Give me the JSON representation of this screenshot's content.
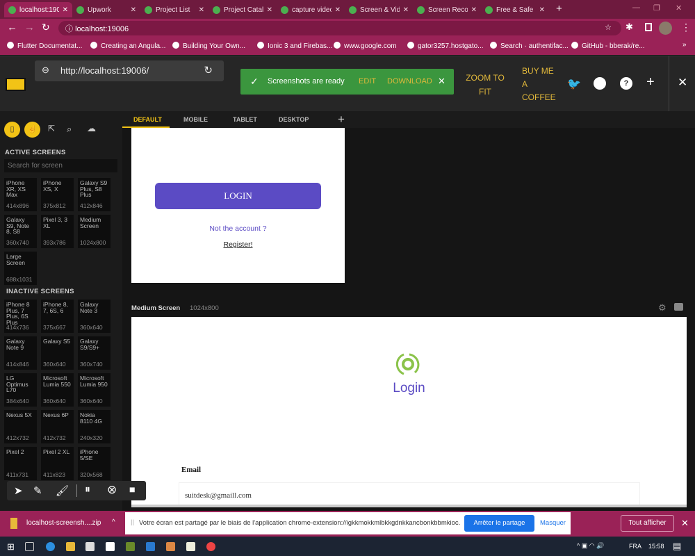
{
  "browser": {
    "tabs": [
      {
        "label": "localhost:19006",
        "active": true
      },
      {
        "label": "Upwork"
      },
      {
        "label": "Project List"
      },
      {
        "label": "Project Catalog"
      },
      {
        "label": "capture video"
      },
      {
        "label": "Screen & Video"
      },
      {
        "label": "Screen Recorder"
      },
      {
        "label": "Free & Safe"
      }
    ],
    "address": "localhost:19006",
    "bookmarks": [
      "Flutter Documentat...",
      "Creating an Angula...",
      "Building Your Own...",
      "Ionic 3 and Firebas...",
      "www.google.com",
      "gator3257.hostgato...",
      "Search · authentifac...",
      "GitHub - bberak/re..."
    ],
    "bookmarks_more": "»"
  },
  "app": {
    "url": "http://localhost:19006/",
    "toast": {
      "message": "Screenshots are ready",
      "edit": "EDIT",
      "download": "DOWNLOAD",
      "close": "✕"
    },
    "zoom_to_fit": "ZOOM TO FIT",
    "buy_coffee": "BUY ME A COFFEE",
    "accent": "#f2c316",
    "sidebar": {
      "active_title": "ACTIVE SCREENS",
      "search_placeholder": "Search for screen",
      "active": [
        {
          "name": "iPhone XR, XS Max",
          "size": "414x896"
        },
        {
          "name": "iPhone XS, X",
          "size": "375x812"
        },
        {
          "name": "Galaxy S9 Plus, S8 Plus",
          "size": "412x846"
        },
        {
          "name": "Galaxy S9, Note 8, S8",
          "size": "360x740"
        },
        {
          "name": "Pixel 3, 3 XL",
          "size": "393x786"
        },
        {
          "name": "Medium Screen",
          "size": "1024x800"
        },
        {
          "name": "Large Screen",
          "size": "688x1031"
        }
      ],
      "inactive_title": "INACTIVE SCREENS",
      "inactive": [
        {
          "name": "iPhone 8 Plus, 7 Plus, 6S Plus",
          "size": "414x736"
        },
        {
          "name": "iPhone 8, 7, 6S, 6",
          "size": "375x667"
        },
        {
          "name": "Galaxy Note 3",
          "size": "360x640"
        },
        {
          "name": "Galaxy Note 9",
          "size": "414x846"
        },
        {
          "name": "Galaxy S5",
          "size": "360x640"
        },
        {
          "name": "Galaxy S9/S9+",
          "size": "360x740"
        },
        {
          "name": "LG Optimus L70",
          "size": "384x640"
        },
        {
          "name": "Microsoft Lumia 550",
          "size": "360x640"
        },
        {
          "name": "Microsoft Lumia 950",
          "size": "360x640"
        },
        {
          "name": "Nexus 5X",
          "size": "412x732"
        },
        {
          "name": "Nexus 6P",
          "size": "412x732"
        },
        {
          "name": "Nokia 8110 4G",
          "size": "240x320"
        },
        {
          "name": "Pixel 2",
          "size": "411x731"
        },
        {
          "name": "Pixel 2 XL",
          "size": "411x823"
        },
        {
          "name": "iPhone 5/SE",
          "size": "320x568"
        }
      ]
    },
    "tabs": [
      "DEFAULT",
      "MOBILE",
      "TABLET",
      "DESKTOP"
    ],
    "preview1": {
      "login_button": "LOGIN",
      "not_account": "Not the account ?",
      "register": "Register!"
    },
    "medium": {
      "title": "Medium Screen",
      "size": "1024x800",
      "heading": "Login",
      "email_label": "Email",
      "email_value": "suitdesk@gmaill.com"
    }
  },
  "downloads": {
    "file": "localhost-screensh....zip",
    "show_all": "Tout afficher"
  },
  "share": {
    "message": "Votre écran est partagé par le biais de l'application chrome-extension://igkkmokkmlbkkgdnkkancbonkbbmkioc.",
    "stop": "Arrêter le partage",
    "hide": "Masquer"
  },
  "taskbar": {
    "lang": "FRA",
    "time": "15:58"
  }
}
